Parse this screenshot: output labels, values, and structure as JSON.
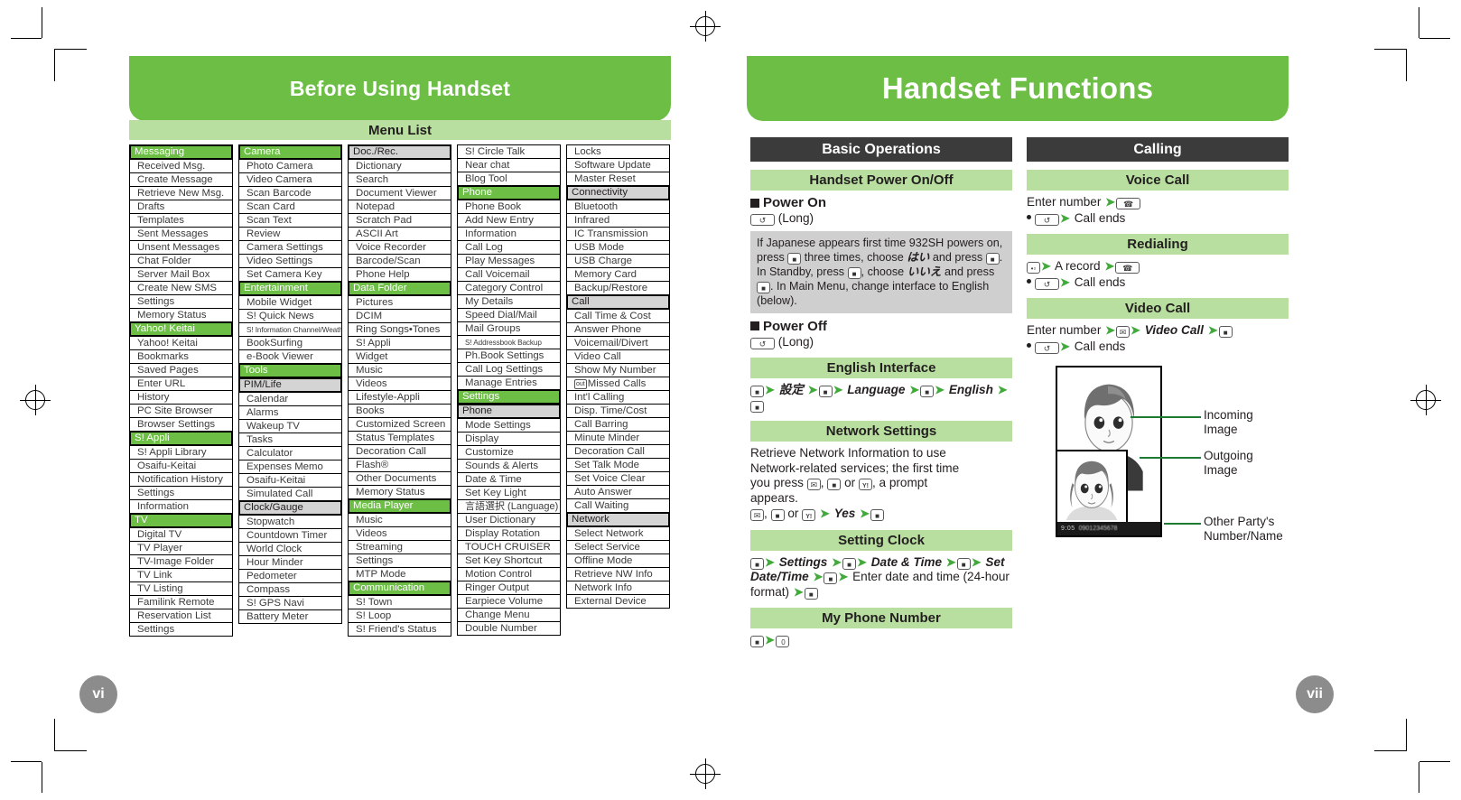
{
  "left_page": {
    "banner_title": "Before Using Handset",
    "section_title": "Menu List",
    "page_number": "vi",
    "columns": [
      {
        "id": "col1",
        "rows": [
          {
            "t": "Messaging",
            "lvl": 1
          },
          {
            "t": "Received Msg."
          },
          {
            "t": "Create Message"
          },
          {
            "t": "Retrieve New Msg."
          },
          {
            "t": "Drafts"
          },
          {
            "t": "Templates"
          },
          {
            "t": "Sent Messages"
          },
          {
            "t": "Unsent Messages"
          },
          {
            "t": "Chat Folder"
          },
          {
            "t": "Server Mail Box"
          },
          {
            "t": "Create New SMS"
          },
          {
            "t": "Settings"
          },
          {
            "t": "Memory Status"
          },
          {
            "t": "Yahoo! Keitai",
            "lvl": 1
          },
          {
            "t": "Yahoo! Keitai"
          },
          {
            "t": "Bookmarks"
          },
          {
            "t": "Saved Pages"
          },
          {
            "t": "Enter URL"
          },
          {
            "t": "History"
          },
          {
            "t": "PC Site Browser"
          },
          {
            "t": "Browser Settings"
          },
          {
            "t": "S! Appli",
            "lvl": 1
          },
          {
            "t": "S! Appli Library"
          },
          {
            "t": "Osaifu-Keitai"
          },
          {
            "t": "Notification History"
          },
          {
            "t": "Settings"
          },
          {
            "t": "Information"
          },
          {
            "t": "TV",
            "lvl": 1
          },
          {
            "t": "Digital TV"
          },
          {
            "t": "TV Player"
          },
          {
            "t": "TV-Image Folder"
          },
          {
            "t": "TV Link"
          },
          {
            "t": "TV Listing"
          },
          {
            "t": "Familink Remote"
          },
          {
            "t": "Reservation List"
          },
          {
            "t": "Settings"
          }
        ]
      },
      {
        "id": "col2",
        "rows": [
          {
            "t": "Camera",
            "lvl": 1
          },
          {
            "t": "Photo Camera"
          },
          {
            "t": "Video Camera"
          },
          {
            "t": "Scan Barcode"
          },
          {
            "t": "Scan Card"
          },
          {
            "t": "Scan Text"
          },
          {
            "t": "Review"
          },
          {
            "t": "Camera Settings"
          },
          {
            "t": "Video Settings"
          },
          {
            "t": "Set Camera Key"
          },
          {
            "t": "Entertainment",
            "lvl": 1
          },
          {
            "t": "Mobile Widget"
          },
          {
            "t": "S! Quick News"
          },
          {
            "t": "S! Information Channel/Weather",
            "tiny": true
          },
          {
            "t": "BookSurfing"
          },
          {
            "t": "e-Book Viewer"
          },
          {
            "t": "Tools",
            "lvl": 1
          },
          {
            "t": "PIM/Life",
            "lvl": 2
          },
          {
            "t": "Calendar"
          },
          {
            "t": "Alarms"
          },
          {
            "t": "Wakeup TV"
          },
          {
            "t": "Tasks"
          },
          {
            "t": "Calculator"
          },
          {
            "t": "Expenses Memo"
          },
          {
            "t": "Osaifu-Keitai"
          },
          {
            "t": "Simulated Call"
          },
          {
            "t": "Clock/Gauge",
            "lvl": 2
          },
          {
            "t": "Stopwatch"
          },
          {
            "t": "Countdown Timer"
          },
          {
            "t": "World Clock"
          },
          {
            "t": "Hour Minder"
          },
          {
            "t": "Pedometer"
          },
          {
            "t": "Compass"
          },
          {
            "t": "S! GPS Navi"
          },
          {
            "t": "Battery Meter"
          }
        ]
      },
      {
        "id": "col3",
        "rows": [
          {
            "t": "Doc./Rec.",
            "lvl": 2
          },
          {
            "t": "Dictionary"
          },
          {
            "t": "Search"
          },
          {
            "t": "Document Viewer"
          },
          {
            "t": "Notepad"
          },
          {
            "t": "Scratch Pad"
          },
          {
            "t": "ASCII Art"
          },
          {
            "t": "Voice Recorder"
          },
          {
            "t": "Barcode/Scan"
          },
          {
            "t": "Phone Help"
          },
          {
            "t": "Data Folder",
            "lvl": 1
          },
          {
            "t": "Pictures"
          },
          {
            "t": "DCIM"
          },
          {
            "t": "Ring Songs•Tones"
          },
          {
            "t": "S! Appli"
          },
          {
            "t": "Widget"
          },
          {
            "t": "Music"
          },
          {
            "t": "Videos"
          },
          {
            "t": "Lifestyle-Appli"
          },
          {
            "t": "Books"
          },
          {
            "t": "Customized Screen"
          },
          {
            "t": "Status Templates"
          },
          {
            "t": "Decoration Call"
          },
          {
            "t": "Flash®"
          },
          {
            "t": "Other Documents"
          },
          {
            "t": "Memory Status"
          },
          {
            "t": "Media Player",
            "lvl": 1
          },
          {
            "t": "Music"
          },
          {
            "t": "Videos"
          },
          {
            "t": "Streaming"
          },
          {
            "t": "Settings"
          },
          {
            "t": "MTP Mode"
          },
          {
            "t": "Communication",
            "lvl": 1
          },
          {
            "t": "S! Town"
          },
          {
            "t": "S! Loop"
          },
          {
            "t": "S! Friend's Status"
          }
        ]
      },
      {
        "id": "col4",
        "rows": [
          {
            "t": "S! Circle Talk"
          },
          {
            "t": "Near chat"
          },
          {
            "t": "Blog Tool"
          },
          {
            "t": "Phone",
            "lvl": 1
          },
          {
            "t": "Phone Book"
          },
          {
            "t": "Add New Entry"
          },
          {
            "t": "Information"
          },
          {
            "t": "Call Log"
          },
          {
            "t": "Play Messages"
          },
          {
            "t": "Call Voicemail"
          },
          {
            "t": "Category Control"
          },
          {
            "t": "My Details"
          },
          {
            "t": "Speed Dial/Mail"
          },
          {
            "t": "Mail Groups"
          },
          {
            "t": "S! Addressbook Backup",
            "tiny": true
          },
          {
            "t": "Ph.Book Settings"
          },
          {
            "t": "Call Log Settings"
          },
          {
            "t": "Manage Entries"
          },
          {
            "t": "Settings",
            "lvl": 1
          },
          {
            "t": "Phone",
            "lvl": 2
          },
          {
            "t": "Mode Settings"
          },
          {
            "t": "Display"
          },
          {
            "t": "Customize"
          },
          {
            "t": "Sounds & Alerts"
          },
          {
            "t": "Date & Time"
          },
          {
            "t": "Set Key Light"
          },
          {
            "t": "言語選択 (Language)",
            "jp": true
          },
          {
            "t": "User Dictionary"
          },
          {
            "t": "Display Rotation"
          },
          {
            "t": "TOUCH CRUISER"
          },
          {
            "t": "Set Key Shortcut"
          },
          {
            "t": "Motion Control"
          },
          {
            "t": "Ringer Output"
          },
          {
            "t": "Earpiece Volume"
          },
          {
            "t": "Change Menu"
          },
          {
            "t": "Double Number"
          }
        ]
      },
      {
        "id": "col5",
        "rows": [
          {
            "t": "Locks"
          },
          {
            "t": "Software Update"
          },
          {
            "t": "Master Reset"
          },
          {
            "t": "Connectivity",
            "lvl": 2
          },
          {
            "t": "Bluetooth"
          },
          {
            "t": "Infrared"
          },
          {
            "t": "IC Transmission"
          },
          {
            "t": "USB Mode"
          },
          {
            "t": "USB Charge"
          },
          {
            "t": "Memory Card"
          },
          {
            "t": "Backup/Restore"
          },
          {
            "t": "Call",
            "lvl": 2
          },
          {
            "t": "Call Time & Cost"
          },
          {
            "t": "Answer Phone"
          },
          {
            "t": "Voicemail/Divert"
          },
          {
            "t": "Video Call"
          },
          {
            "t": "Show My Number"
          },
          {
            "t": "Missed Calls",
            "key": "out"
          },
          {
            "t": "Int'l Calling"
          },
          {
            "t": "Disp. Time/Cost"
          },
          {
            "t": "Call Barring"
          },
          {
            "t": "Minute Minder"
          },
          {
            "t": "Decoration Call"
          },
          {
            "t": "Set Talk Mode"
          },
          {
            "t": "Set Voice Clear"
          },
          {
            "t": "Auto Answer"
          },
          {
            "t": "Call Waiting"
          },
          {
            "t": "Network",
            "lvl": 2
          },
          {
            "t": "Select Network"
          },
          {
            "t": "Select Service"
          },
          {
            "t": "Offline Mode"
          },
          {
            "t": "Retrieve NW Info"
          },
          {
            "t": "Network Info"
          },
          {
            "t": "External Device"
          }
        ]
      }
    ]
  },
  "right_page": {
    "banner_title": "Handset Functions",
    "page_number": "vii",
    "basic_operations": {
      "section_title": "Basic Operations",
      "power": {
        "subtitle": "Handset Power On/Off",
        "power_on_label": "Power On",
        "power_on_keys": "(Long)",
        "note": "If Japanese appears first time 932SH powers on, press ■ three times, choose はい and press ■. In Standby, press ■, choose いいえ and press ■. In Main Menu, change interface to English (below).",
        "note_jp_yes": "はい",
        "note_jp_no": "いいえ",
        "power_off_label": "Power Off",
        "power_off_keys": "(Long)"
      },
      "english_interface": {
        "subtitle": "English Interface",
        "step_settings_jp": "設定",
        "step_language": "Language",
        "step_english": "English"
      },
      "network_settings": {
        "subtitle": "Network Settings",
        "body": "Retrieve Network Information to use Network-related services; the first time you press , or , a prompt appears.",
        "body_line1": "Retrieve Network Information to use",
        "body_line2": "Network-related services; the first time",
        "body_line3_pre": "you press",
        "body_line3_mid": "or",
        "body_line3_post": ", a prompt",
        "body_line4": "appears.",
        "step_or": "or",
        "step_yes": "Yes"
      },
      "setting_clock": {
        "subtitle": "Setting Clock",
        "step_settings": "Settings",
        "step_datetime": "Date & Time",
        "step_setdatetime": "Set Date/Time",
        "step_enter": "Enter date and time (24-hour format)"
      },
      "my_phone_number": {
        "subtitle": "My Phone Number"
      }
    },
    "calling": {
      "section_title": "Calling",
      "voice_call": {
        "subtitle": "Voice Call",
        "step_enter": "Enter number",
        "end_note": "Call ends"
      },
      "redialing": {
        "subtitle": "Redialing",
        "step_record": "A record",
        "end_note": "Call ends"
      },
      "video_call": {
        "subtitle": "Video Call",
        "step_enter": "Enter number",
        "step_videocall": "Video Call",
        "end_note": "Call ends"
      },
      "figure": {
        "callouts": [
          "Incoming Image",
          "Outgoing Image",
          "Other Party's\nNumber/Name"
        ],
        "callout1": "Incoming Image",
        "callout2": "Outgoing Image",
        "callout3_line1": "Other Party's",
        "callout3_line2": "Number/Name",
        "status_time": "9:05",
        "status_number": "09012345678"
      }
    }
  },
  "colors": {
    "brand_green": "#6cbe45",
    "light_green": "#b9dfa0",
    "dark_bar": "#3b3b3b",
    "gray_box": "#cfcfcf",
    "level2_gray": "#d4d4d4",
    "page_badge": "#8c8c8c",
    "arrow_green": "#42a93b"
  }
}
